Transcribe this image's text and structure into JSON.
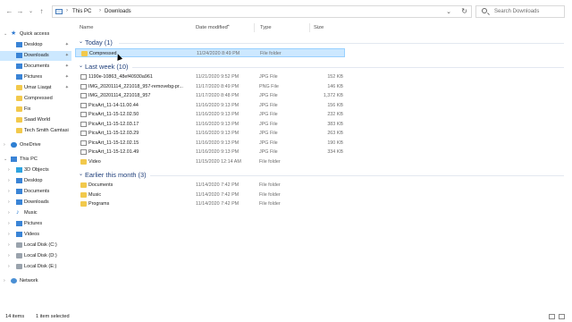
{
  "address_bar": {
    "back_icon": "arrow-left-icon",
    "forward_icon": "arrow-right-icon",
    "recent_icon": "chevron-down-icon",
    "up_icon": "arrow-up-icon",
    "crumbs": [
      "This PC",
      "Downloads"
    ],
    "search_placeholder": "Search Downloads"
  },
  "nav_pane": {
    "items": [
      {
        "label": "Quick access",
        "icon": "star-icon",
        "expanded": true
      },
      {
        "label": "Desktop",
        "icon": "desktop-icon",
        "pinned": true
      },
      {
        "label": "Downloads",
        "icon": "downloads-icon",
        "pinned": true,
        "selected": true
      },
      {
        "label": "Documents",
        "icon": "documents-icon",
        "pinned": true
      },
      {
        "label": "Pictures",
        "icon": "pictures-icon",
        "pinned": true
      },
      {
        "label": "Umar Liaqat",
        "icon": "folder-icon",
        "pinned": true
      },
      {
        "label": "Compressed",
        "icon": "folder-icon"
      },
      {
        "label": "Fix",
        "icon": "folder-icon"
      },
      {
        "label": "Saad World",
        "icon": "folder-icon"
      },
      {
        "label": "Tech Smith Camtasi",
        "icon": "folder-icon"
      },
      {
        "label": "OneDrive",
        "icon": "cloud-icon"
      },
      {
        "label": "This PC",
        "icon": "computer-icon",
        "expanded": true
      },
      {
        "label": "3D Objects",
        "icon": "3d-objects-icon"
      },
      {
        "label": "Desktop",
        "icon": "desktop-icon"
      },
      {
        "label": "Documents",
        "icon": "documents-icon"
      },
      {
        "label": "Downloads",
        "icon": "downloads-icon"
      },
      {
        "label": "Music",
        "icon": "music-icon"
      },
      {
        "label": "Pictures",
        "icon": "pictures-icon"
      },
      {
        "label": "Videos",
        "icon": "videos-icon"
      },
      {
        "label": "Local Disk (C:)",
        "icon": "drive-icon"
      },
      {
        "label": "Local Disk (D:)",
        "icon": "drive-icon"
      },
      {
        "label": "Local Disk (E:)",
        "icon": "drive-icon"
      },
      {
        "label": "Network",
        "icon": "network-icon"
      }
    ]
  },
  "columns": {
    "name": "Name",
    "date": "Date modified",
    "type": "Type",
    "size": "Size"
  },
  "groups": [
    {
      "title": "Today (1)",
      "rows": [
        {
          "name": "Compressed",
          "date": "11/24/2020 8:49 PM",
          "type": "File folder",
          "size": "",
          "kind": "folder",
          "selected": true
        }
      ]
    },
    {
      "title": "Last week (10)",
      "rows": [
        {
          "name": "1190e-10863_48ef40930a961",
          "date": "11/21/2020 9:52 PM",
          "type": "JPG File",
          "size": "152 KB",
          "kind": "file"
        },
        {
          "name": "IMG_20201114_221018_957-removebg-pr...",
          "date": "11/17/2020 8:49 PM",
          "type": "PNG File",
          "size": "146 KB",
          "kind": "file"
        },
        {
          "name": "IMG_20201114_221018_957",
          "date": "11/17/2020 8:48 PM",
          "type": "JPG File",
          "size": "1,372 KB",
          "kind": "file"
        },
        {
          "name": "PicsArt_11-14-11.00.44",
          "date": "11/16/2020 9:13 PM",
          "type": "JPG File",
          "size": "156 KB",
          "kind": "file"
        },
        {
          "name": "PicsArt_11-15-12.02.50",
          "date": "11/16/2020 9:13 PM",
          "type": "JPG File",
          "size": "232 KB",
          "kind": "file"
        },
        {
          "name": "PicsArt_11-15-12.03.17",
          "date": "11/16/2020 9:13 PM",
          "type": "JPG File",
          "size": "383 KB",
          "kind": "file"
        },
        {
          "name": "PicsArt_11-15-12.03.29",
          "date": "11/16/2020 9:13 PM",
          "type": "JPG File",
          "size": "263 KB",
          "kind": "file"
        },
        {
          "name": "PicsArt_11-15-12.02.15",
          "date": "11/16/2020 9:13 PM",
          "type": "JPG File",
          "size": "190 KB",
          "kind": "file"
        },
        {
          "name": "PicsArt_11-15-12.01.49",
          "date": "11/16/2020 9:13 PM",
          "type": "JPG File",
          "size": "334 KB",
          "kind": "file"
        },
        {
          "name": "Video",
          "date": "11/15/2020 12:14 AM",
          "type": "File folder",
          "size": "",
          "kind": "folder"
        }
      ]
    },
    {
      "title": "Earlier this month (3)",
      "rows": [
        {
          "name": "Documents",
          "date": "11/14/2020 7:42 PM",
          "type": "File folder",
          "size": "",
          "kind": "folder"
        },
        {
          "name": "Music",
          "date": "11/14/2020 7:42 PM",
          "type": "File folder",
          "size": "",
          "kind": "folder"
        },
        {
          "name": "Programs",
          "date": "11/14/2020 7:42 PM",
          "type": "File folder",
          "size": "",
          "kind": "folder"
        }
      ]
    }
  ],
  "status": {
    "count": "14 items",
    "selection": "1 item selected"
  },
  "colors": {
    "selection": "#cce8ff",
    "group_header": "#1e3e7a",
    "folder": "#f2c94c"
  }
}
